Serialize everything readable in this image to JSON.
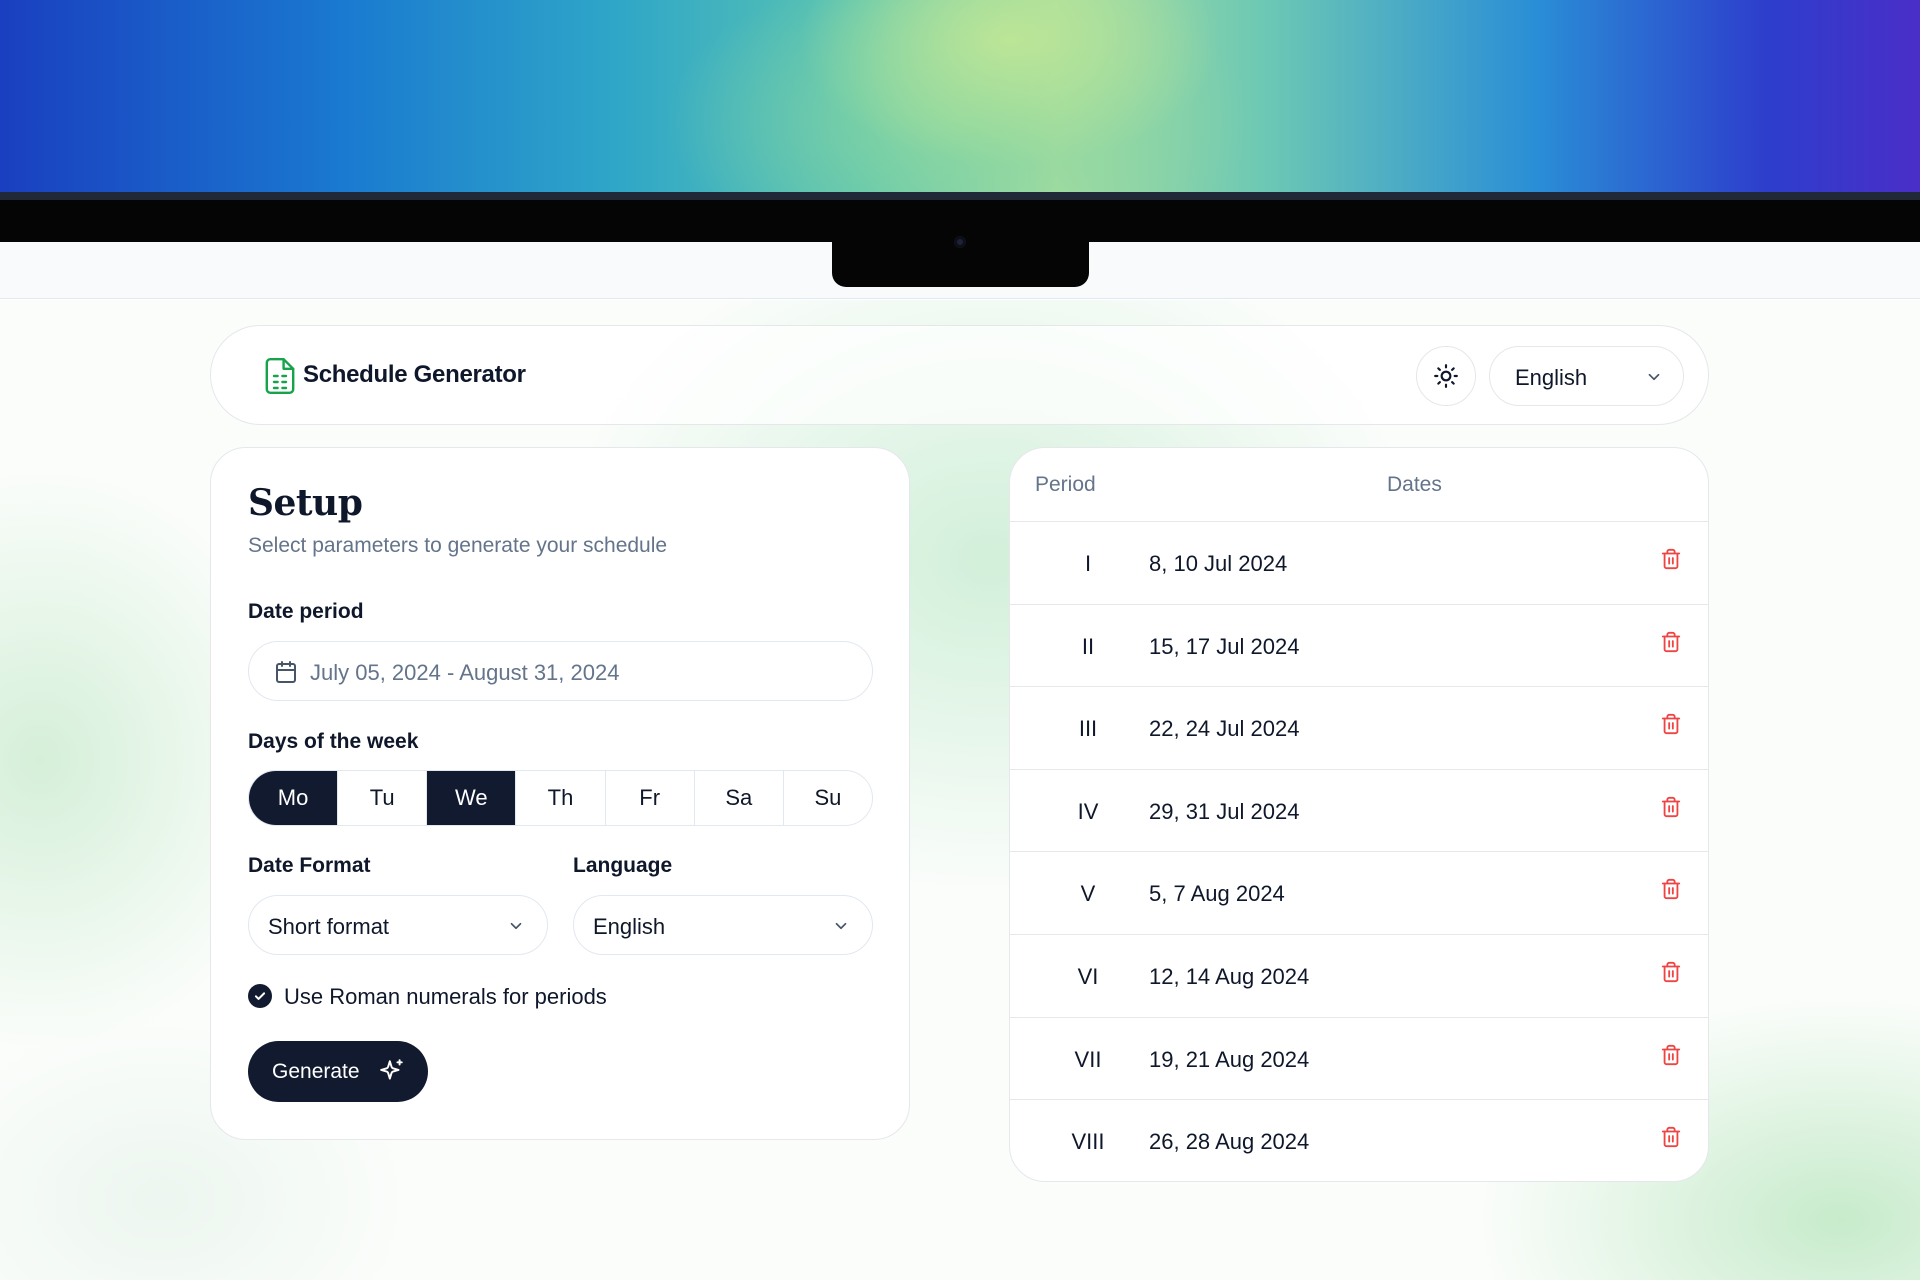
{
  "colors": {
    "accent": "#111a2e",
    "brand_icon": "#16a34a",
    "delete": "#ef4444",
    "muted": "#64748b",
    "border": "#e5e7eb"
  },
  "header": {
    "title": "Schedule Generator",
    "theme_toggle_icon": "sun-icon",
    "language": "English"
  },
  "setup": {
    "title": "Setup",
    "subtitle": "Select parameters to generate your schedule",
    "date_period_label": "Date period",
    "date_period_value": "July 05, 2024 - August 31, 2024",
    "days_label": "Days of the week",
    "days": [
      {
        "label": "Mo",
        "selected": true
      },
      {
        "label": "Tu",
        "selected": false
      },
      {
        "label": "We",
        "selected": true
      },
      {
        "label": "Th",
        "selected": false
      },
      {
        "label": "Fr",
        "selected": false
      },
      {
        "label": "Sa",
        "selected": false
      },
      {
        "label": "Su",
        "selected": false
      }
    ],
    "date_format_label": "Date Format",
    "date_format_value": "Short format",
    "language_label": "Language",
    "language_value": "English",
    "roman_label": "Use Roman numerals for periods",
    "roman_checked": true,
    "generate_label": "Generate"
  },
  "schedule": {
    "columns": {
      "period": "Period",
      "dates": "Dates"
    },
    "rows": [
      {
        "period": "I",
        "dates": "8, 10 Jul 2024"
      },
      {
        "period": "II",
        "dates": "15, 17 Jul 2024"
      },
      {
        "period": "III",
        "dates": "22, 24 Jul 2024"
      },
      {
        "period": "IV",
        "dates": "29, 31 Jul 2024"
      },
      {
        "period": "V",
        "dates": "5, 7 Aug 2024"
      },
      {
        "period": "VI",
        "dates": "12, 14 Aug 2024"
      },
      {
        "period": "VII",
        "dates": "19, 21 Aug 2024"
      },
      {
        "period": "VIII",
        "dates": "26, 28 Aug 2024"
      }
    ]
  }
}
